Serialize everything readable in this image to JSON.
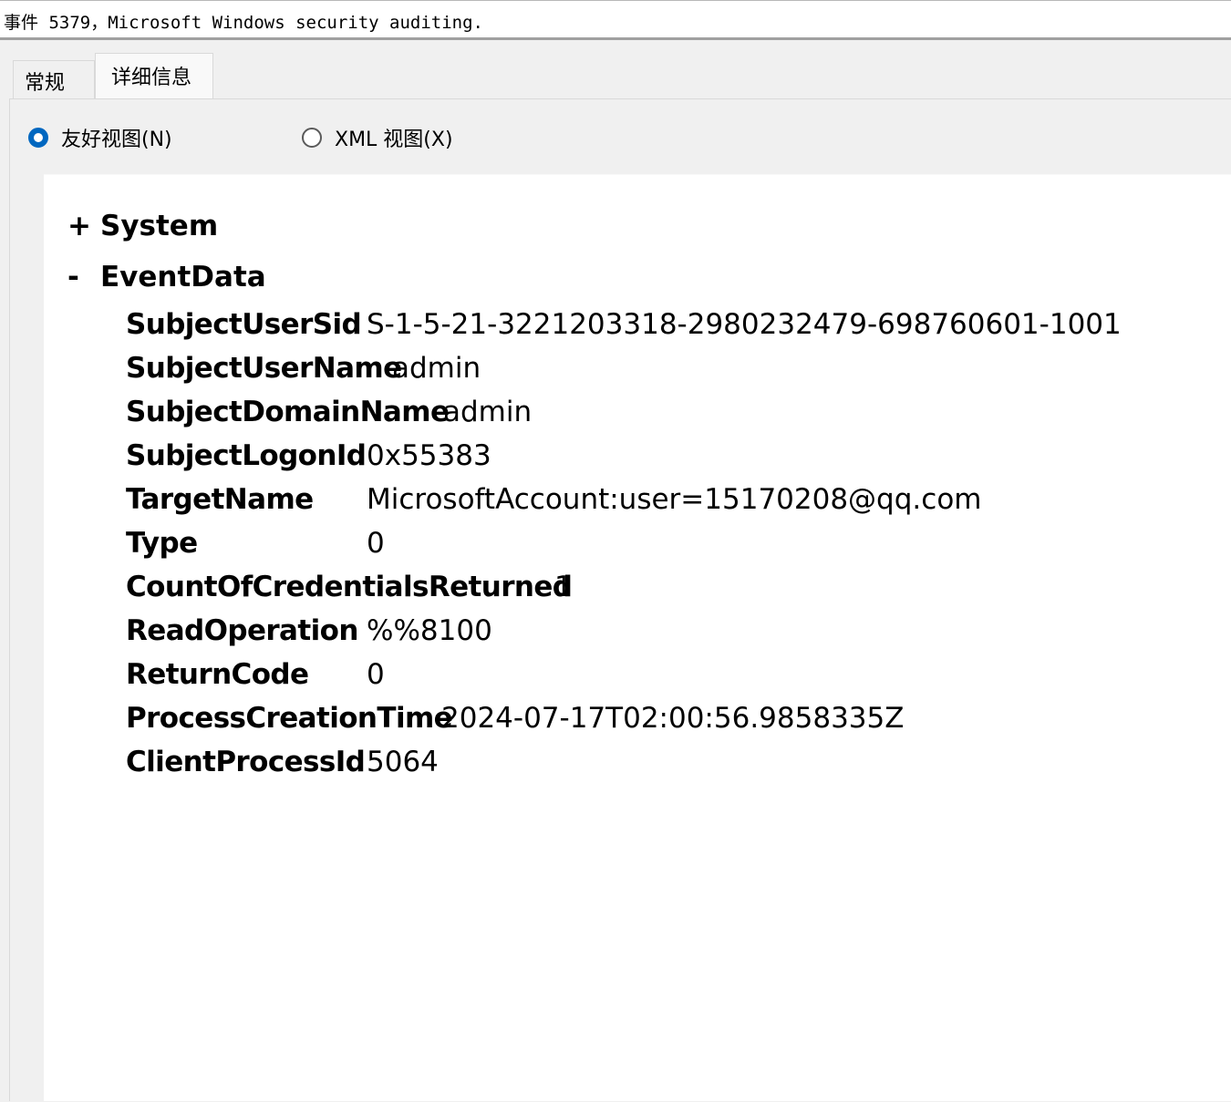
{
  "window": {
    "title": "事件 5379，Microsoft Windows security auditing."
  },
  "tabs": [
    {
      "label": "常规",
      "selected": false
    },
    {
      "label": "详细信息",
      "selected": true
    }
  ],
  "view_options": {
    "friendly": {
      "label": "友好视图(N)",
      "checked": true
    },
    "xml": {
      "label": "XML 视图(X)",
      "checked": false
    }
  },
  "tree": {
    "system": {
      "toggle": "+",
      "label": "System"
    },
    "eventdata": {
      "toggle": "-",
      "label": "EventData"
    },
    "fields": [
      {
        "key": "SubjectUserSid",
        "value": "S-1-5-21-3221203318-2980232479-698760601-1001"
      },
      {
        "key": "SubjectUserName",
        "value": "admin"
      },
      {
        "key": "SubjectDomainName",
        "value": "admin"
      },
      {
        "key": "SubjectLogonId",
        "value": "0x55383"
      },
      {
        "key": "TargetName",
        "value": "MicrosoftAccount:user=15170208@qq.com"
      },
      {
        "key": "Type",
        "value": "0"
      },
      {
        "key": "CountOfCredentialsReturned",
        "value": "1"
      },
      {
        "key": "ReadOperation",
        "value": "%%8100"
      },
      {
        "key": "ReturnCode",
        "value": "0"
      },
      {
        "key": "ProcessCreationTime",
        "value": "2024-07-17T02:00:56.9858335Z"
      },
      {
        "key": "ClientProcessId",
        "value": "5064"
      }
    ]
  },
  "colors": {
    "radio_accent": "#0067c0",
    "content_bg": "#ffffff",
    "chrome_bg": "#f0f0f0"
  }
}
